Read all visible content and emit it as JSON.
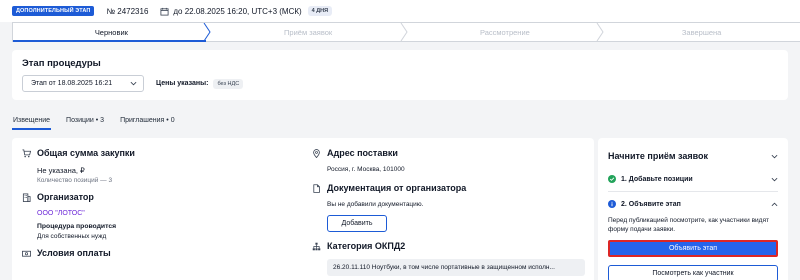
{
  "topbar": {
    "stage_tag": "ДОПОЛНИТЕЛЬНЫЙ ЭТАП",
    "number": "№ 2472316",
    "deadline": "до 22.08.2025 16:20, UTC+3 (МСК)",
    "days_badge": "4 ДНЯ"
  },
  "stepper": {
    "steps": [
      {
        "label": "Черновик",
        "active": true
      },
      {
        "label": "Приём заявок",
        "active": false
      },
      {
        "label": "Рассмотрение",
        "active": false
      },
      {
        "label": "Завершена",
        "active": false
      }
    ]
  },
  "procedure": {
    "title": "Этап процедуры",
    "stage_select": "Этап от 18.08.2025 16:21",
    "prices_label": "Цены указаны:",
    "vat_badge": "без НДС"
  },
  "tabs": [
    {
      "label": "Извещение",
      "active": true
    },
    {
      "label": "Позиции • 3",
      "active": false
    },
    {
      "label": "Приглашения • 0",
      "active": false
    }
  ],
  "details": {
    "total": {
      "title": "Общая сумма закупки",
      "value": "Не указана, ₽",
      "positions": "Количество позиций — 3"
    },
    "organizer": {
      "title": "Организатор",
      "name": "ООО \"ЛОТОС\"",
      "conducted_label": "Процедура проводится",
      "conducted_value": "Для собственных нужд"
    },
    "payment": {
      "title": "Условия оплаты"
    },
    "delivery": {
      "title": "Адрес поставки",
      "address": "Россия, г. Москва, 101000"
    },
    "docs": {
      "title": "Документация от организатора",
      "empty": "Вы не добавили документацию.",
      "add_button": "Добавить"
    },
    "okpd": {
      "title": "Категория ОКПД2",
      "value": "26.20.11.110 Ноутбуки, в том числе портативные в защищенном исполн..."
    }
  },
  "panel": {
    "title": "Начните приём заявок",
    "step1": "1. Добавьте позиции",
    "step2": "2. Объявите этап",
    "description": "Перед публикацией посмотрите, как участники видят форму подачи заявки.",
    "primary_button": "Объявить этап",
    "secondary_button": "Посмотреть как участник"
  },
  "colors": {
    "accent": "#1d5bd6",
    "primary_button": "#2563eb",
    "highlight_border": "#dc2626",
    "success": "#22a35a",
    "link": "#6d28d9"
  }
}
